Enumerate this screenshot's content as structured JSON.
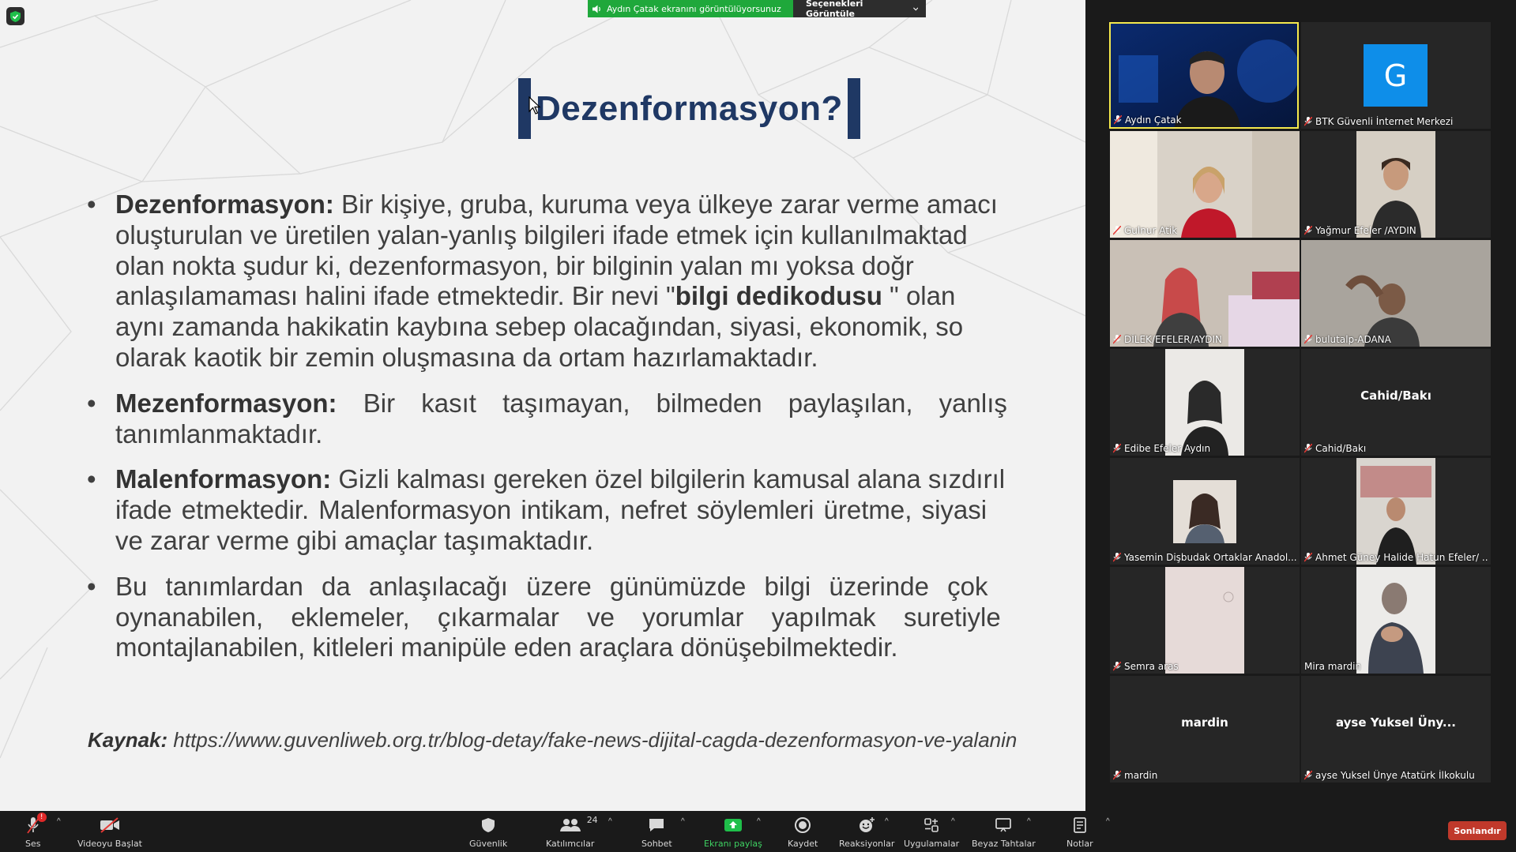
{
  "banner": {
    "sharing_text": "Aydın Çatak ekranını görüntülüyorsunuz",
    "options_label": "Seçenekleri Görüntüle"
  },
  "slide": {
    "title": "Dezenformasyon?",
    "bullets": [
      {
        "term": "Dezenformasyon:",
        "lines": [
          " Bir kişiye, gruba, kuruma veya ülkeye zarar verme amacı",
          "oluşturulan ve üretilen yalan-yanlış bilgileri ifade etmek için kullanılmaktad",
          "olan nokta şudur ki, dezenformasyon, bir bilginin yalan mı yoksa doğr",
          "anlaşılamaması halini ifade etmektedir. Bir nevi \"",
          "aynı zamanda hakikatin kaybına sebep olacağından, siyasi, ekonomik, so",
          "olarak kaotik bir zemin oluşmasına da ortam hazırlamaktadır."
        ],
        "bold_phrase": "bilgi dedikodusu",
        "after_bold": " \" olan"
      },
      {
        "term": "Mezenformasyon:",
        "lines": [
          " Bir kasıt taşımayan, bilmeden paylaşılan, yanlış",
          "tanımlanmaktadır."
        ]
      },
      {
        "term": "Malenformasyon:",
        "lines": [
          " Gizli kalması gereken özel bilgilerin kamusal alana sızdırıl",
          "ifade etmektedir. Malenformasyon intikam, nefret söylemleri üretme, siyasi",
          "ve zarar verme gibi amaçlar taşımaktadır."
        ]
      },
      {
        "term": "",
        "lines": [
          "Bu tanımlardan da anlaşılacağı üzere günümüzde bilgi üzerinde çok",
          "oynanabilen, eklemeler, çıkarmalar ve yorumlar yapılmak suretiyle",
          "montajlanabilen, kitleleri manipüle eden araçlara dönüşebilmektedir."
        ]
      }
    ],
    "source_label": "Kaynak:",
    "source_url": " https://www.guvenliweb.org.tr/blog-detay/fake-news-dijital-cagda-dezenformasyon-ve-yalanin"
  },
  "participants": [
    {
      "name": "Aydın Çatak",
      "active": true
    },
    {
      "name": "BTK Güvenli İnternet Merkezi",
      "avatar_letter": "G"
    },
    {
      "name": "Gulnur Atik"
    },
    {
      "name": "Yağmur Efeler /AYDIN"
    },
    {
      "name": "DİLEK/EFELER/AYDIN"
    },
    {
      "name": "bulutalp-ADANA"
    },
    {
      "name": "Edibe Efeler Aydın"
    },
    {
      "name": "Cahid/Bakı",
      "display": "Cahid/Bakı"
    },
    {
      "name": "Yasemin Dişbudak Ortaklar Anadol..."
    },
    {
      "name": "Ahmet Güney Halide Hatun Efeler/ ..."
    },
    {
      "name": "Semra aras"
    },
    {
      "name": "Mira mardin"
    },
    {
      "name": "mardin",
      "display": "mardin"
    },
    {
      "name": "ayse Yuksel Ünye Atatürk İlkokulu",
      "display": "ayse Yuksel Üny..."
    }
  ],
  "toolbar": {
    "audio": "Ses",
    "audio_badge": "!",
    "video": "Videoyu Başlat",
    "security": "Güvenlik",
    "participants": "Katılımcılar",
    "participants_count": "24",
    "chat": "Sohbet",
    "share": "Ekranı paylaş",
    "record": "Kaydet",
    "reactions": "Reaksiyonlar",
    "apps": "Uygulamalar",
    "whiteboards": "Beyaz Tahtalar",
    "notes": "Notlar",
    "end": "Sonlandır"
  },
  "colors": {
    "title": "#1f3864",
    "share_green": "#1fa83b",
    "end_red": "#c0392b",
    "active_speaker": "#f5e94d"
  }
}
